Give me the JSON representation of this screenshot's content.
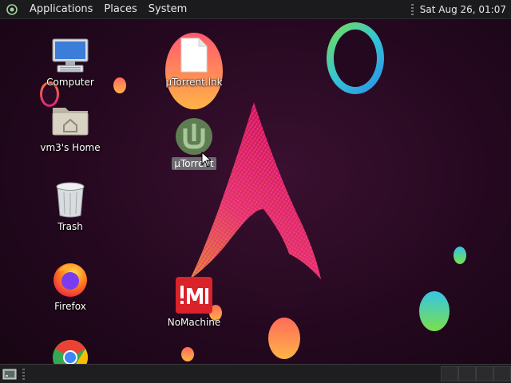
{
  "top_panel": {
    "menus": [
      "Applications",
      "Places",
      "System"
    ],
    "clock": "Sat Aug 26, 01:07"
  },
  "desktop": {
    "icons": [
      {
        "label": "Computer",
        "icon": "computer-icon"
      },
      {
        "label": "vm3's Home",
        "icon": "home-folder-icon"
      },
      {
        "label": "Trash",
        "icon": "trash-icon"
      },
      {
        "label": "Firefox",
        "icon": "firefox-icon"
      },
      {
        "label": "",
        "icon": "chrome-icon"
      },
      {
        "label": "µTorrent.lnk",
        "icon": "file-icon"
      },
      {
        "label": "µTorrent",
        "icon": "utorrent-icon"
      },
      {
        "label": "NoMachine",
        "icon": "nomachine-icon"
      }
    ]
  },
  "colors": {
    "panel": "#1b1b1d",
    "selection": "#6b6b70",
    "nomachine_red": "#d9222a",
    "utorrent_green": "#6aa84f"
  }
}
